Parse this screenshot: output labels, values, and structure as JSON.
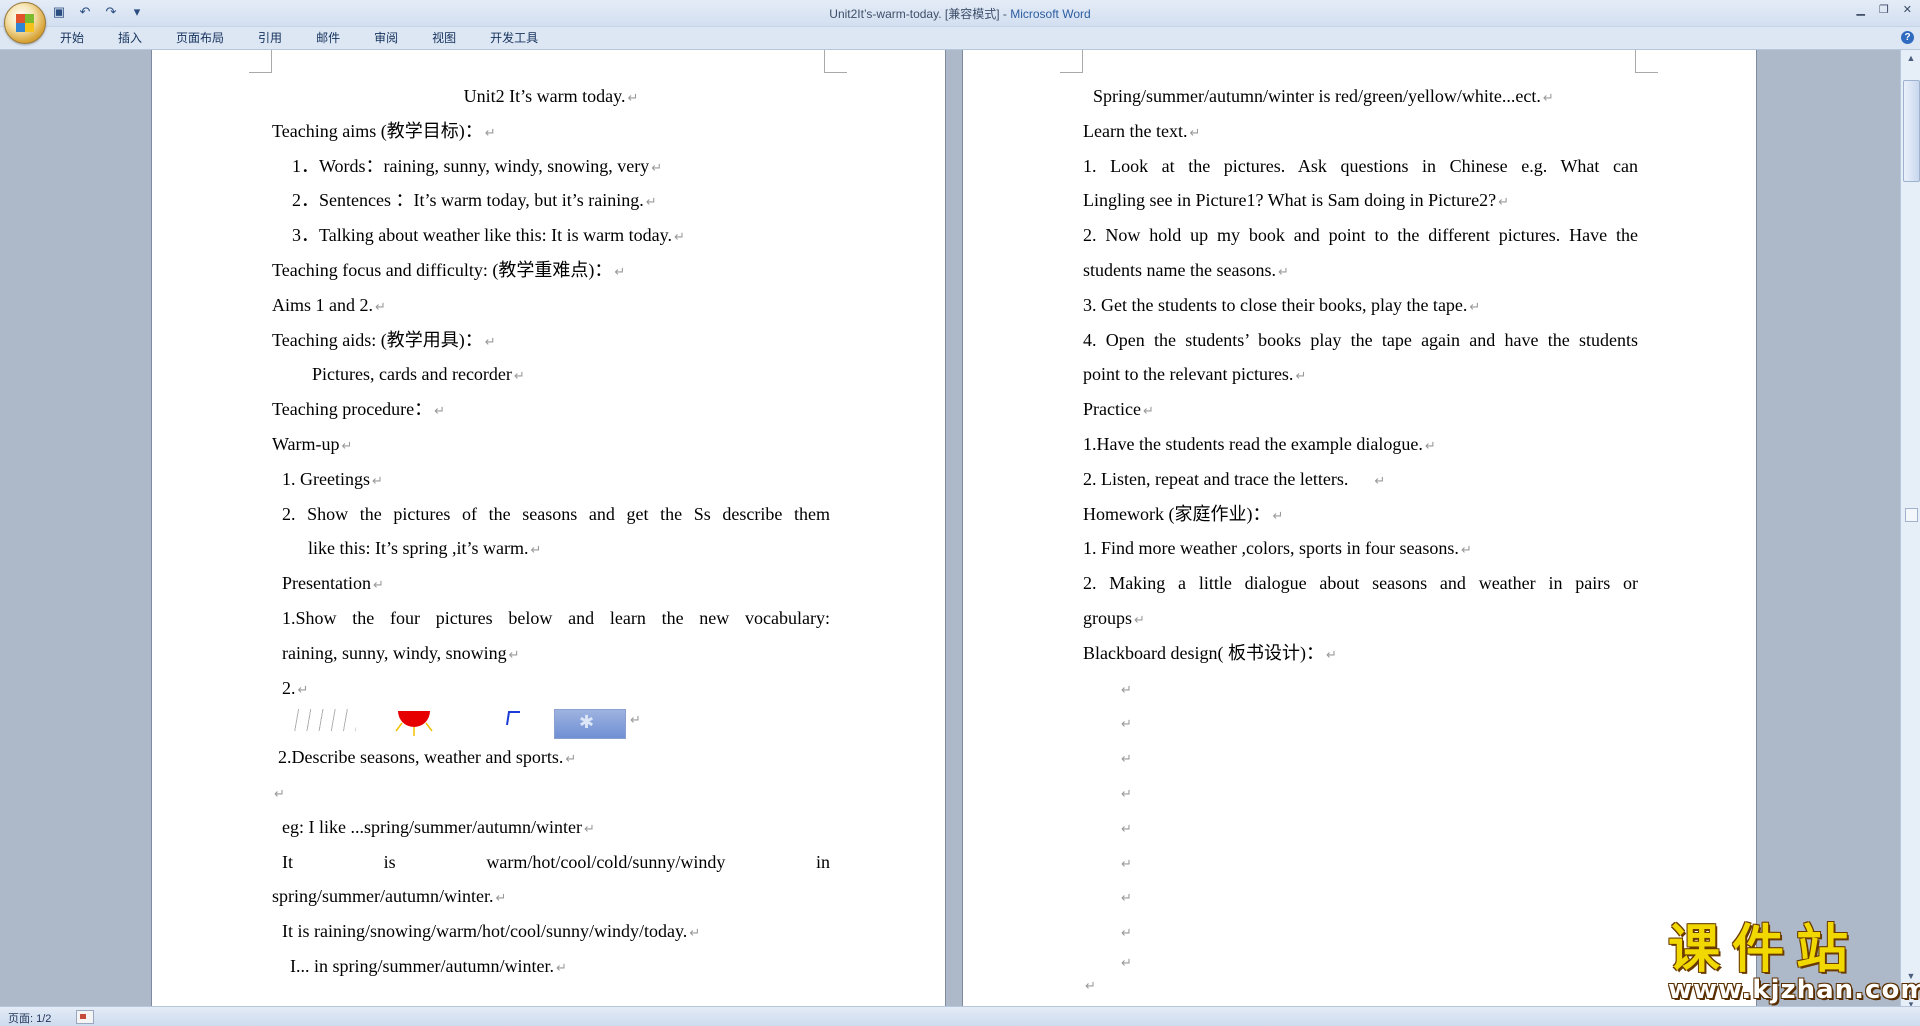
{
  "window": {
    "title_doc": "Unit2It’s-warm-today. [兼容模式] - ",
    "title_app": "Microsoft Word"
  },
  "ribbon": {
    "tabs": [
      "开始",
      "插入",
      "页面布局",
      "引用",
      "邮件",
      "审阅",
      "视图",
      "开发工具"
    ]
  },
  "page1": {
    "lines": [
      "Unit2 It’s warm today.",
      "Teaching aims (教学目标)：",
      "1．Words：raining, sunny, windy, snowing, very",
      "2．Sentences ：It’s warm today, but it’s raining.",
      "3．Talking about weather like this: It is warm today.",
      "Teaching focus and difficulty: (教学重难点)：",
      "Aims 1 and 2.",
      "Teaching aids: (教学用具)：",
      "Pictures, cards and recorder",
      "Teaching procedure：",
      "Warm-up",
      "1. Greetings",
      "2. Show the pictures of the seasons and get the Ss describe them",
      "like this: It’s spring ,it’s warm.",
      "Presentation",
      "1.Show the four pictures below and learn the new vocabulary:",
      "raining, sunny, windy, snowing",
      "2.",
      "",
      "2.Describe seasons, weather and sports.",
      "",
      "eg: I like ...spring/summer/autumn/winter",
      "It is warm/hot/cool/cold/sunny/windy in",
      "spring/summer/autumn/winter.",
      "It is raining/snowing/warm/hot/cool/sunny/windy/today.",
      "I... in spring/summer/autumn/winter."
    ]
  },
  "page2": {
    "lines": [
      "Spring/summer/autumn/winter is red/green/yellow/white...ect.",
      "Learn the text.",
      "1. Look at the pictures. Ask questions in Chinese e.g. What can",
      "Lingling see in Picture1? What is Sam doing in Picture2?",
      "2. Now hold up my book and point to the different pictures. Have the",
      "students name the seasons.",
      "3. Get the students to close their books, play the tape.",
      "4. Open the students’ books play the tape again and have the students",
      "point to the relevant pictures.",
      "Practice",
      "1.Have the students read the example dialogue.",
      "2. Listen, repeat and trace the letters.",
      "Homework (家庭作业)：",
      "1. Find more weather ,colors, sports in four seasons.",
      "2. Making a little dialogue about seasons and weather in pairs or",
      "groups",
      "Blackboard design( 板书设计)："
    ]
  },
  "status": {
    "page": "页面: 1/2"
  },
  "watermark": {
    "cn": "课件站",
    "url": "www.kjzhan.com"
  },
  "colors": {
    "accent": "#2d5da0",
    "workspace": "#adb9c9",
    "watermark_yellow": "#f0d800"
  }
}
